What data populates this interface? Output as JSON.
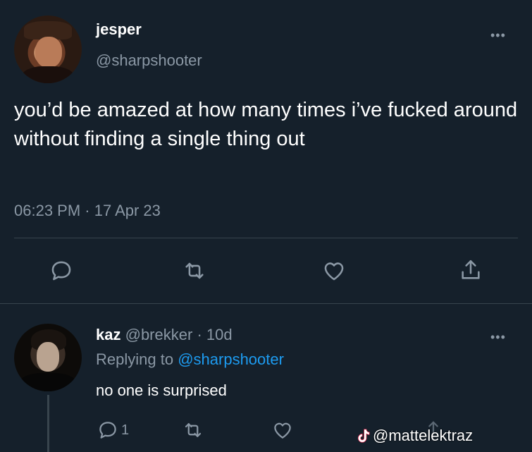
{
  "tweet": {
    "name": "jesper",
    "handle": "@sharpshooter",
    "text": "you’d be amazed at how many times i’ve fucked around without finding a single thing out",
    "timestamp": "06:23 PM · 17 Apr 23",
    "more": "•••"
  },
  "reply": {
    "name": "kaz",
    "handle": "@brekker",
    "separator": "·",
    "age": "10d",
    "replying_prefix": "Replying to",
    "replying_handle": "@sharpshooter",
    "text": "no one is surprised",
    "reply_count": "1",
    "more": "•••"
  },
  "watermark": {
    "handle": "@mattelektraz",
    "icon": "tiktok-icon"
  },
  "colors": {
    "background": "#15202b",
    "secondary_text": "#8b98a5",
    "link": "#1d9bf0",
    "divider": "#38444d"
  }
}
